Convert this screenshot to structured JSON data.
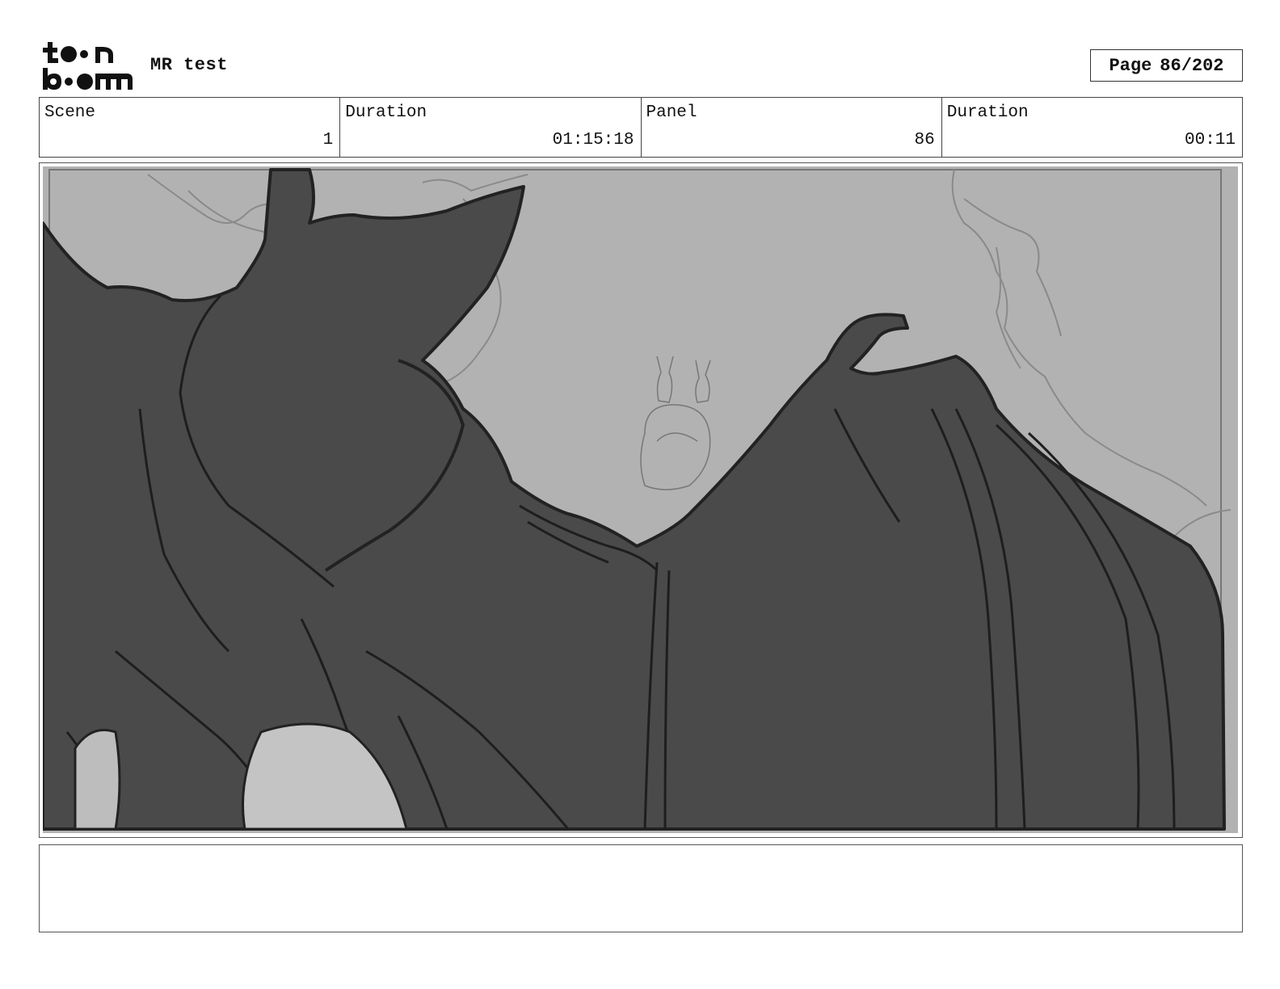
{
  "header": {
    "logo": {
      "line1": "toon",
      "line2": "boom",
      "icon": "toon-boom-logo"
    },
    "project_title": "MR test",
    "page": {
      "label": "Page",
      "value": "86/202"
    }
  },
  "info": {
    "scene_label": "Scene",
    "scene_value": "1",
    "scene_duration_label": "Duration",
    "scene_duration_value": "01:15:18",
    "panel_label": "Panel",
    "panel_value": "86",
    "panel_duration_label": "Duration",
    "panel_duration_value": "00:11"
  },
  "panel": {
    "image_icon": "storyboard-sketch-bat-creature"
  },
  "notes": {
    "text": ""
  }
}
